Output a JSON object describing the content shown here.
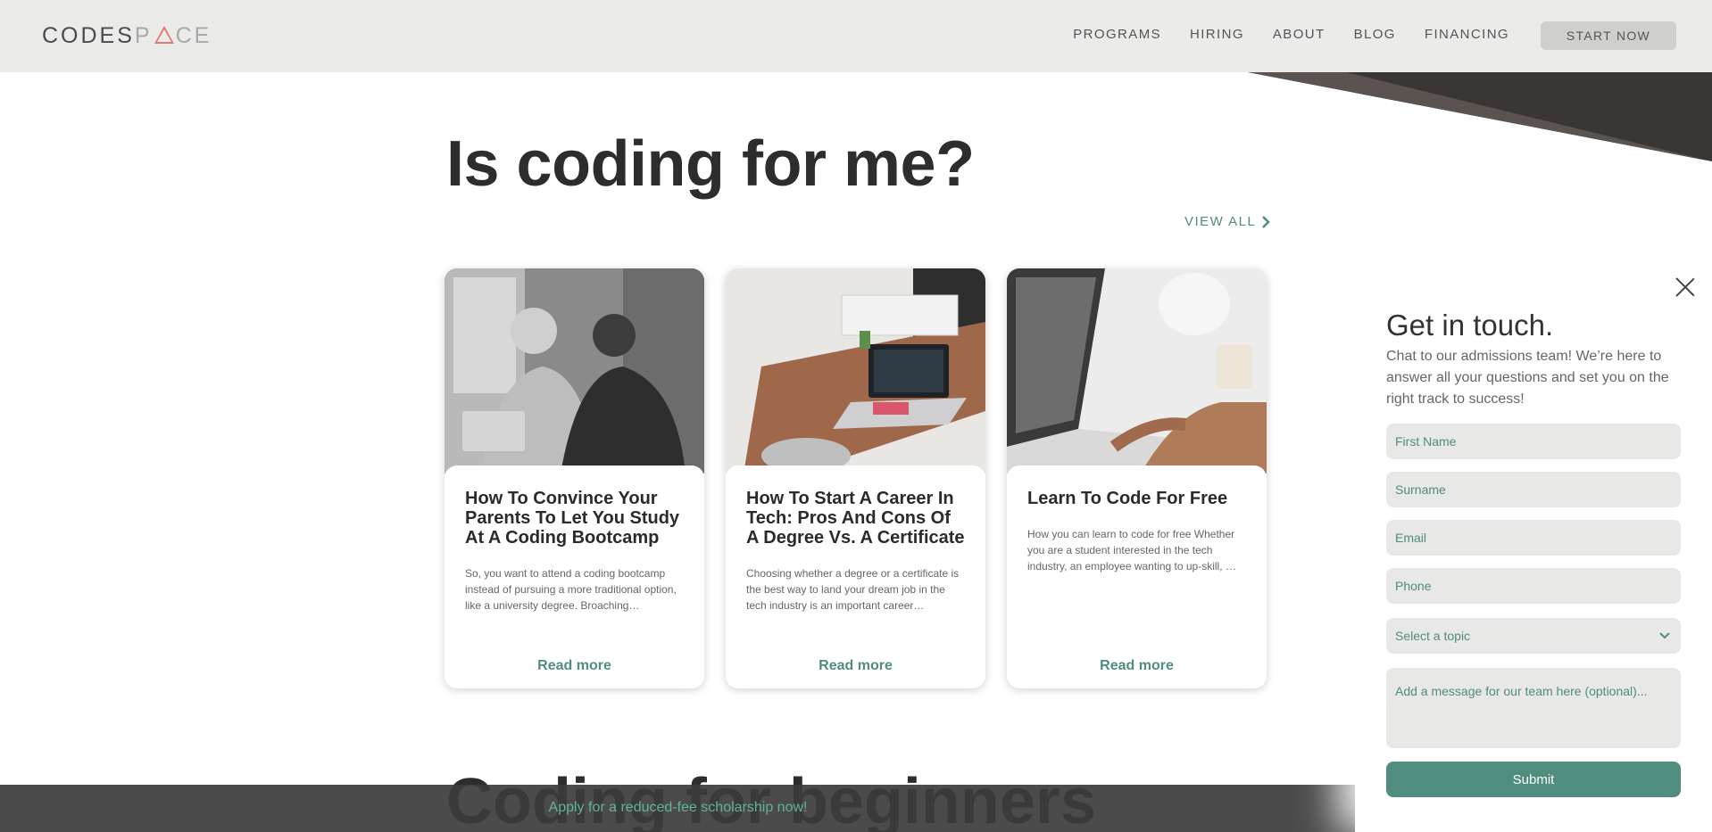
{
  "header": {
    "logo_part1": "CODES",
    "logo_part2": "P",
    "logo_part3": "CE",
    "nav": [
      {
        "label": "PROGRAMS"
      },
      {
        "label": "HIRING"
      },
      {
        "label": "ABOUT"
      },
      {
        "label": "BLOG"
      },
      {
        "label": "FINANCING"
      }
    ],
    "cta_label": "START NOW"
  },
  "section": {
    "title": "Is coding for me?",
    "view_all": "VIEW ALL"
  },
  "cards": [
    {
      "title": "How To Convince Your Parents To Let You Study At A Coding Bootcamp",
      "excerpt": "So, you want to attend a coding bootcamp instead of pursuing a more traditional option, like a university degree. Broaching…",
      "read_more": "Read more"
    },
    {
      "title": "How To Start A Career In Tech: Pros And Cons Of A Degree Vs. A Certificate",
      "excerpt": "Choosing whether a degree or a certificate is the best way to land your dream job in the tech industry is an important career…",
      "read_more": "Read more"
    },
    {
      "title": "Learn To Code For Free",
      "excerpt": "How you can learn to code for free Whether you are a student interested in the tech industry, an employee wanting to up-skill, …",
      "read_more": "Read more"
    }
  ],
  "section2": {
    "title": "Coding for beginners"
  },
  "banner": {
    "text": "Apply for a reduced-fee scholarship now!"
  },
  "contact": {
    "title": "Get in touch.",
    "description": "Chat to our admissions team! We’re here to answer all your questions and set you on the right track to success!",
    "first_name_placeholder": "First Name",
    "surname_placeholder": "Surname",
    "email_placeholder": "Email",
    "phone_placeholder": "Phone",
    "topic_selected": "Select a topic",
    "message_placeholder": "Add a message for our team here (optional)...",
    "submit_label": "Submit"
  },
  "colors": {
    "accent": "#4f8d7f",
    "header_bg": "#ebebe9",
    "field_bg": "#e8e8e6",
    "banner_bg": "#3c3c3c"
  }
}
